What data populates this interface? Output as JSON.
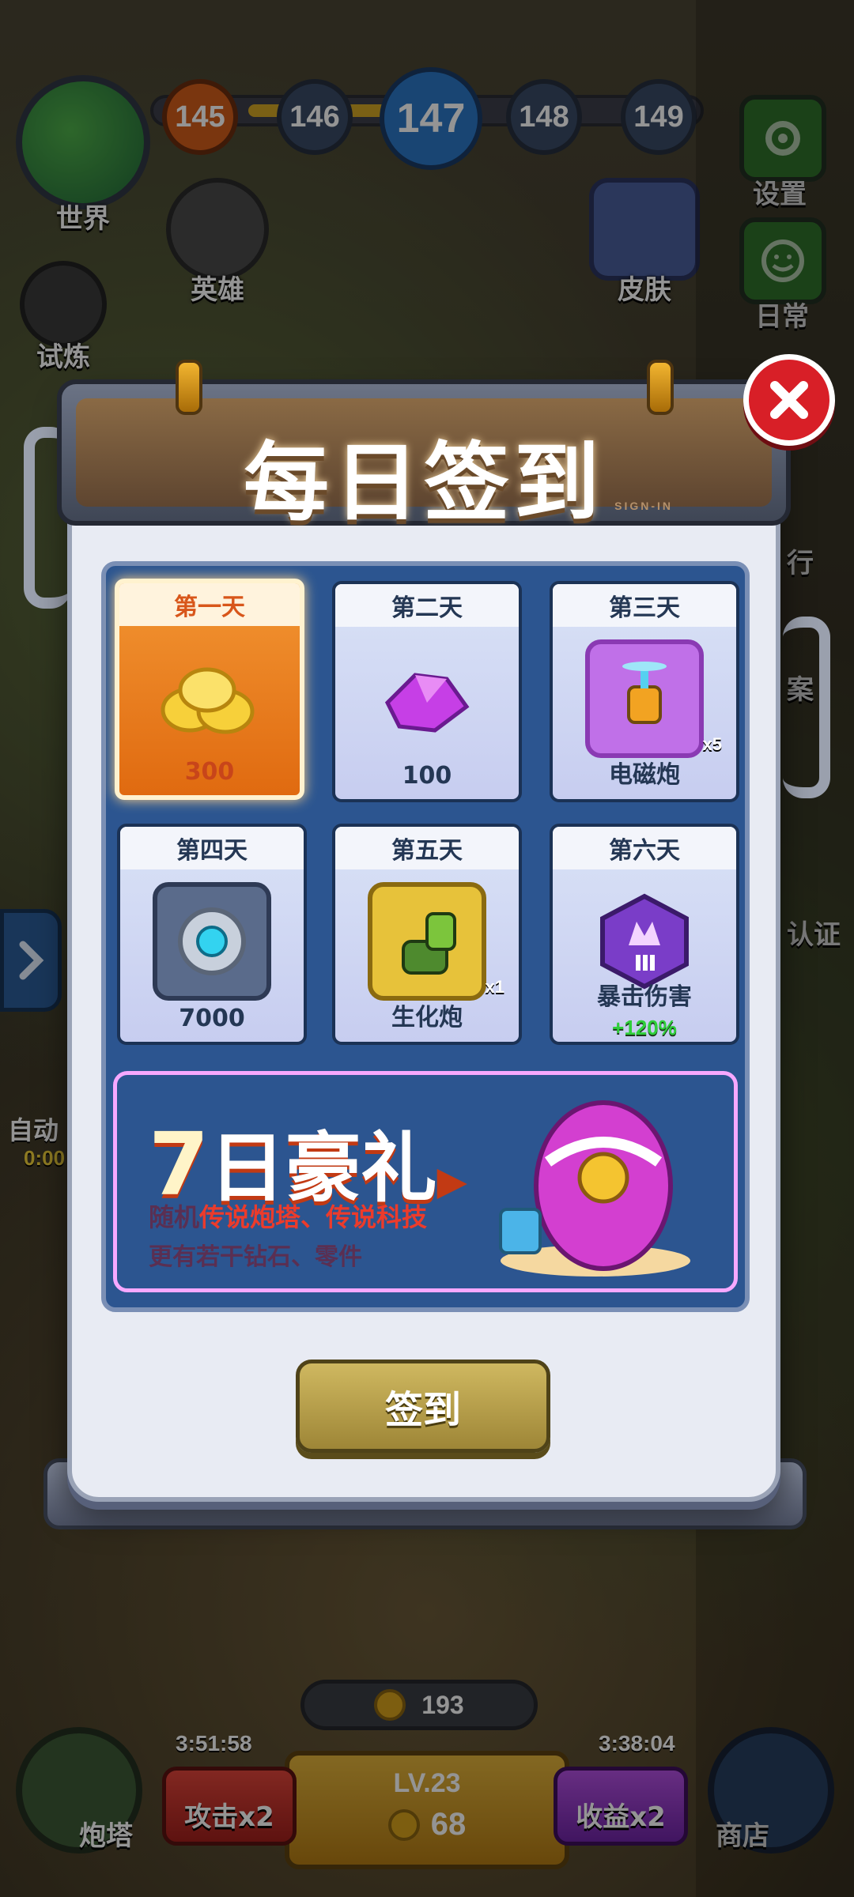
{
  "hud": {
    "world_label": "世界",
    "hero_label": "英雄",
    "trial_label": "试炼",
    "skin_label": "皮肤",
    "settings_label": "设置",
    "daily_label": "日常",
    "side_partial_1": "行",
    "side_partial_2": "案",
    "side_partial_3": "认证",
    "auto_label": "自动",
    "auto_time": "0:00",
    "levels": [
      "145",
      "146",
      "147",
      "148",
      "149"
    ]
  },
  "dialog": {
    "title": "每日签到",
    "subtitle": "SIGN-IN",
    "days": [
      {
        "label": "第一天",
        "value": "300",
        "icon": "gold-coins-icon",
        "active": true
      },
      {
        "label": "第二天",
        "value": "100",
        "icon": "purple-diamond-icon"
      },
      {
        "label": "第三天",
        "value": "电磁炮",
        "qty": "x5",
        "icon": "electromagnetic-cannon-icon"
      },
      {
        "label": "第四天",
        "value": "7000",
        "icon": "gear-part-icon"
      },
      {
        "label": "第五天",
        "value": "生化炮",
        "qty": "x1",
        "icon": "biochemical-cannon-icon"
      },
      {
        "label": "第六天",
        "value": "暴击伤害",
        "value2": "+120%",
        "icon": "crit-damage-icon"
      }
    ],
    "promo": {
      "title_num": "7",
      "title_text": "日豪礼",
      "line1_prefix": "随机",
      "line1_highlight": "传说炮塔、传说科技",
      "line2": "更有若干钻石、零件"
    },
    "signin_button": "签到"
  },
  "bottom": {
    "coin_count": "193",
    "level": "LV.23",
    "center_value": "68",
    "timer_left": "3:51:58",
    "timer_right": "3:38:04",
    "attack_label": "攻击x2",
    "income_label": "收益x2",
    "tower_tab": "炮塔",
    "shop_tab": "商店"
  },
  "colors": {
    "active_card": "#e8751c",
    "card_bg": "#d1d9f3",
    "grid_bg": "#2c5590",
    "close_red": "#d81f27",
    "signin_btn": "#b39e4a"
  }
}
